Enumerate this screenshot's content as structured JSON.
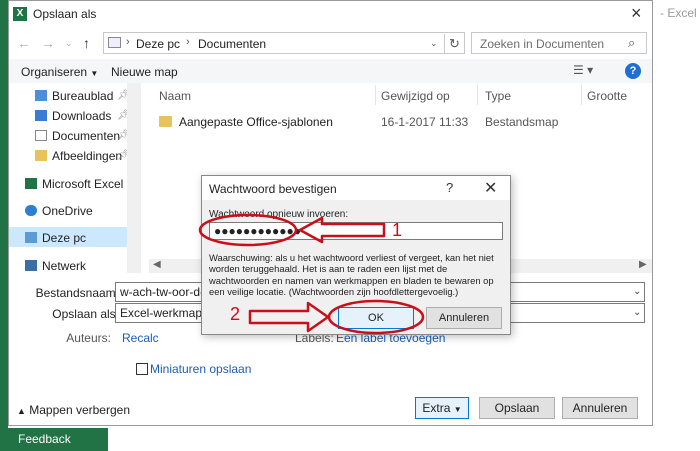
{
  "background_app": {
    "title_fragment": "- Excel",
    "feedback_label": "Feedback"
  },
  "file_dialog": {
    "title": "Opslaan als",
    "address": {
      "segments": [
        "Deze pc",
        "Documenten"
      ]
    },
    "search_placeholder": "Zoeken in Documenten",
    "toolbar": {
      "organize_label": "Organiseren",
      "new_folder_label": "Nieuwe map",
      "help_label": "?"
    },
    "nav_items": [
      {
        "label": "Bureaublad",
        "pinned": true
      },
      {
        "label": "Downloads",
        "pinned": true
      },
      {
        "label": "Documenten",
        "pinned": true
      },
      {
        "label": "Afbeeldingen",
        "pinned": true
      },
      {
        "label": "Microsoft Excel",
        "pinned": false
      },
      {
        "label": "OneDrive",
        "pinned": false
      },
      {
        "label": "Deze pc",
        "pinned": false,
        "selected": true
      },
      {
        "label": "Netwerk",
        "pinned": false
      }
    ],
    "columns": [
      "Naam",
      "Gewijzigd op",
      "Type",
      "Grootte"
    ],
    "files": [
      {
        "name": "Aangepaste Office-sjablonen",
        "modified": "16-1-2017 11:33",
        "type": "Bestandsmap",
        "size": ""
      }
    ],
    "filename_label": "Bestandsnaam:",
    "filename_value": "w-ach-tw-oor-d-e",
    "savetype_label": "Opslaan als:",
    "savetype_value": "Excel-werkmap",
    "authors_label": "Auteurs:",
    "authors_value": "Recalc",
    "tags_label": "Labels:",
    "tags_value": "Een label toevoegen",
    "thumbnails_label": "Miniaturen opslaan",
    "hide_folders_label": "Mappen verbergen",
    "extra_label": "Extra",
    "save_label": "Opslaan",
    "cancel_label": "Annuleren"
  },
  "password_dialog": {
    "title": "Wachtwoord bevestigen",
    "help_label": "?",
    "reenter_label": "Wachtwoord opnieuw invoeren:",
    "password_masked": "●●●●●●●●●●●●",
    "warning": "Waarschuwing: als u het wachtwoord verliest of vergeet, kan het niet worden teruggehaald. Het is aan te raden een lijst met de wachtwoorden en namen van werkmappen en bladen te bewaren op een veilige locatie. (Wachtwoorden zijn hoofdlettergevoelig.)",
    "ok_label": "OK",
    "cancel_label": "Annuleren"
  },
  "annotations": {
    "step1": "1",
    "step2": "2",
    "color": "#c8101a"
  }
}
